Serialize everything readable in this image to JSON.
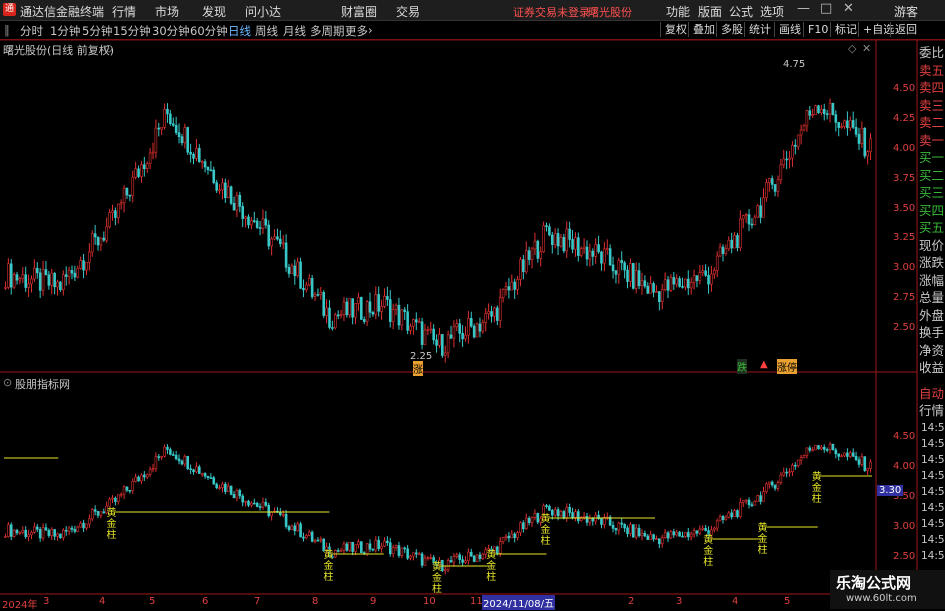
{
  "titlebar": {
    "app_name": "通达信金融终端",
    "menus": [
      "行情",
      "市场",
      "发现",
      "问小达",
      "财富圈",
      "交易"
    ],
    "notice": "证券交易未登录",
    "stock_name": "曙光股份",
    "right_menus": [
      "功能",
      "版面",
      "公式",
      "选项"
    ],
    "user": "游客",
    "window_controls": [
      "—",
      "□",
      "✕"
    ]
  },
  "period_bar": {
    "items": [
      "分时",
      "1分钟",
      "5分钟",
      "15分钟",
      "30分钟",
      "60分钟",
      "日线",
      "周线",
      "月线",
      "多周期",
      "更多"
    ],
    "active": "日线",
    "right_tools": [
      "复权",
      "叠加",
      "多股",
      "统计",
      "画线",
      "F10",
      "标记",
      "+自选",
      "返回"
    ]
  },
  "main_panel": {
    "title": "曙光股份(日线 前复权)",
    "price_ticks": [
      "4.50",
      "4.25",
      "4.00",
      "3.75",
      "3.50",
      "3.25",
      "3.00",
      "2.75",
      "2.50"
    ],
    "high_label": "4.75",
    "low_label": "2.25",
    "markers": [
      "跌",
      "涨停"
    ]
  },
  "indicator_panel": {
    "title": "股朋指标网",
    "price_ticks": [
      "4.50",
      "4.00",
      "3.50",
      "3.00",
      "2.50"
    ],
    "current_value": "3.30",
    "signal_text": "黄金柱"
  },
  "right_panel": {
    "labels": [
      "委比",
      "卖五",
      "卖四",
      "卖三",
      "卖二",
      "卖一",
      "买一",
      "买二",
      "买三",
      "买四",
      "买五",
      "现价",
      "涨跌",
      "涨幅",
      "总量",
      "外盘",
      "换手",
      "净资",
      "收益"
    ],
    "tabs": [
      "自动",
      "行情"
    ],
    "times": [
      "14:56",
      "14:56",
      "14:56",
      "14:56",
      "14:56",
      "14:56",
      "14:56",
      "14:56",
      "14:56"
    ]
  },
  "date_axis": {
    "labels": [
      "2024年",
      "3",
      "4",
      "5",
      "6",
      "7",
      "8",
      "9",
      "10",
      "11",
      "2",
      "3",
      "4",
      "5"
    ],
    "selected": "2024/11/08/五"
  },
  "watermark": {
    "line1": "乐淘公式网",
    "line2": "www.60lt.com"
  },
  "colors": {
    "up": "#e03030",
    "down": "#38c8c8",
    "axis": "#e04040",
    "signal": "#e8e828",
    "active": "#6ab7ff"
  },
  "chart_data": {
    "type": "candlestick",
    "title": "曙光股份(日线 前复权)",
    "y_range": [
      2.25,
      4.75
    ],
    "series": [
      {
        "name": "close",
        "x": [
          "2024-01",
          "2024-02",
          "2024-03",
          "2024-04",
          "2024-05",
          "2024-06",
          "2024-07",
          "2024-08",
          "2024-09",
          "2024-10",
          "2024-11",
          "2024-12",
          "2025-01",
          "2025-02",
          "2025-03",
          "2025-04",
          "2025-05"
        ],
        "values": [
          2.95,
          2.85,
          3.4,
          4.3,
          3.7,
          3.2,
          2.6,
          2.7,
          2.35,
          2.6,
          3.3,
          3.1,
          2.8,
          2.95,
          3.55,
          4.4,
          4.0
        ]
      }
    ],
    "extremes": {
      "high": 4.75,
      "low": 2.25
    },
    "signal_levels": [
      {
        "value": 4.15,
        "start": "2024-01",
        "end": "2024-02"
      },
      {
        "value": 3.25,
        "start": "2024-03",
        "end": "2024-07"
      },
      {
        "value": 2.55,
        "start": "2024-07",
        "end": "2024-08"
      },
      {
        "value": 2.35,
        "start": "2024-09",
        "end": "2024-10"
      },
      {
        "value": 2.55,
        "start": "2024-10",
        "end": "2024-11"
      },
      {
        "value": 3.15,
        "start": "2024-11",
        "end": "2025-01"
      },
      {
        "value": 2.8,
        "start": "2025-02",
        "end": "2025-03"
      },
      {
        "value": 3.0,
        "start": "2025-03",
        "end": "2025-04"
      },
      {
        "value": 3.85,
        "start": "2025-04",
        "end": "2025-05"
      }
    ]
  }
}
